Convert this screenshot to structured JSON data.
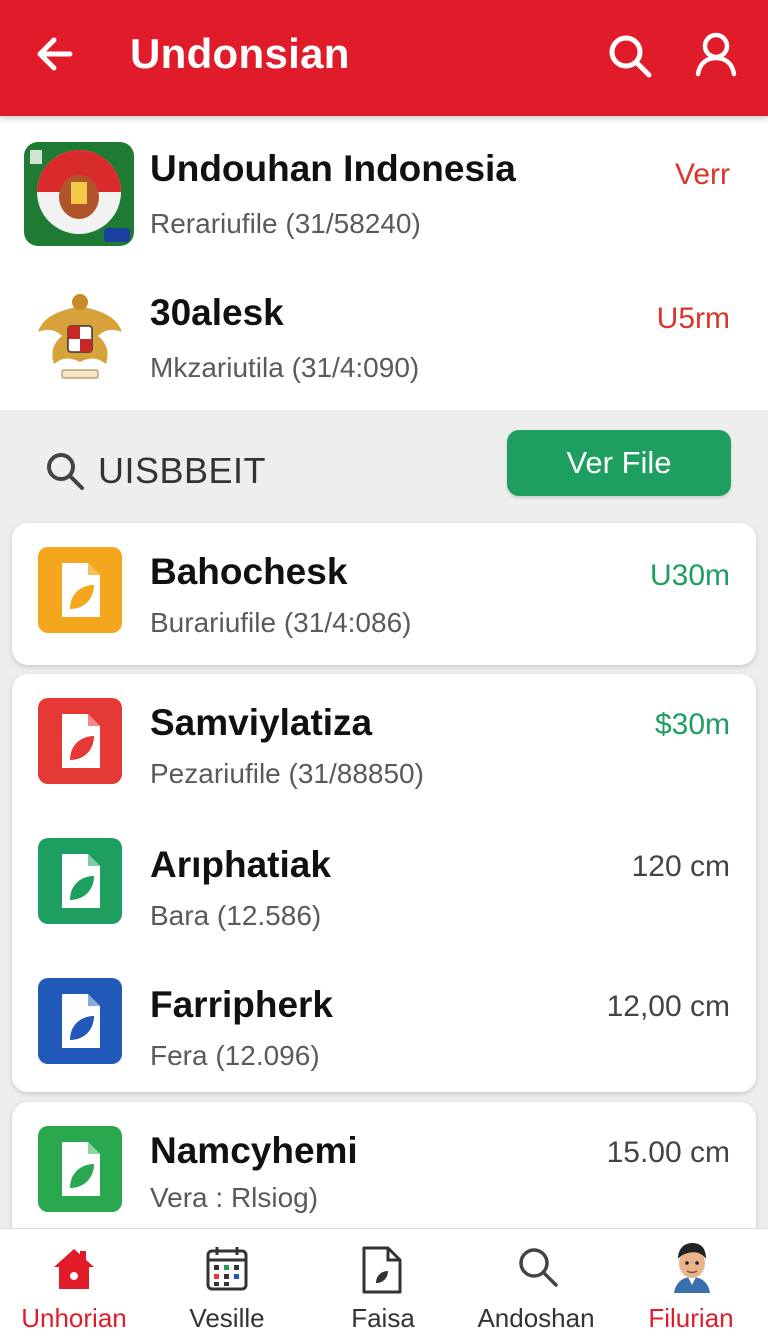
{
  "header": {
    "title": "Undonsian"
  },
  "top_items": [
    {
      "name": "Undouhan Indonesia",
      "sub": "Rerariufile (31/58240)",
      "size": "Verr",
      "size_color": "#d9352b"
    },
    {
      "name": "30alesk",
      "sub": "Mkzariutila (31/4:090)",
      "size": "U5rm",
      "size_color": "#d9352b"
    }
  ],
  "filter": {
    "label": "UISBBEIT",
    "button": "Ver File"
  },
  "files": [
    {
      "name": "Bahochesk",
      "sub": "Burariufile (31/4:086)",
      "size": "U30m",
      "size_color": "#1e9e5f",
      "icon_color": "#f4a61c",
      "icon": "file-leaf-icon"
    },
    {
      "name": "Samviylatiza",
      "sub": "Pezariufile (31/88850)",
      "size": "$30m",
      "size_color": "#1e9e5f",
      "icon_color": "#e53935",
      "icon": "file-leaf-icon"
    },
    {
      "name": "Arıphatiak",
      "sub": "Bara (12.586)",
      "size": "120 cm",
      "size_color": "#444444",
      "icon_color": "#1e9e5f",
      "icon": "file-leaf-icon"
    },
    {
      "name": "Farripherk",
      "sub": "Fera (12.096)",
      "size": "12,00 cm",
      "size_color": "#444444",
      "icon_color": "#2159b8",
      "icon": "file-leaf-icon"
    },
    {
      "name": "Namcyhemi",
      "sub": "Vera : Rlsiog)",
      "size": "15.00 cm",
      "size_color": "#444444",
      "icon_color": "#2aa84f",
      "icon": "file-leaf-icon"
    }
  ],
  "nav": [
    {
      "label": "Unhorian",
      "icon": "home-icon",
      "active": true
    },
    {
      "label": "Vesille",
      "icon": "calendar-icon",
      "active": false
    },
    {
      "label": "Faisa",
      "icon": "document-icon",
      "active": false
    },
    {
      "label": "Andoshan",
      "icon": "search-icon",
      "active": false
    },
    {
      "label": "Filurian",
      "icon": "profile-avatar",
      "active": true
    }
  ],
  "colors": {
    "primary_red": "#e01b2a",
    "accent_green": "#1e9e5f"
  }
}
